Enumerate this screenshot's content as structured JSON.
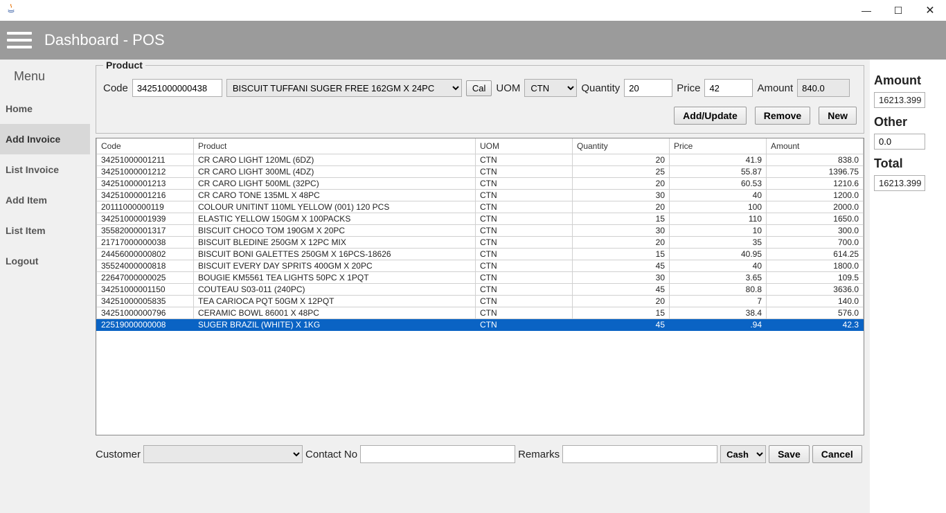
{
  "window": {
    "title": "Dashboard - POS"
  },
  "sidebar": {
    "menu_label": "Menu",
    "items": [
      {
        "label": "Home"
      },
      {
        "label": "Add Invoice"
      },
      {
        "label": "List Invoice"
      },
      {
        "label": "Add Item"
      },
      {
        "label": "List Item"
      },
      {
        "label": "Logout"
      }
    ],
    "active_index": 1
  },
  "product": {
    "legend": "Product",
    "code_label": "Code",
    "code_value": "34251000000438",
    "name_value": "BISCUIT TUFFANI SUGER FREE 162GM X 24PC",
    "cal_label": "Cal",
    "uom_label": "UOM",
    "uom_value": "CTN",
    "qty_label": "Quantity",
    "qty_value": "20",
    "price_label": "Price",
    "price_value": "42",
    "amount_label": "Amount",
    "amount_value": "840.0"
  },
  "buttons": {
    "add_update": "Add/Update",
    "remove": "Remove",
    "new": "New",
    "save": "Save",
    "cancel": "Cancel"
  },
  "table": {
    "headers": [
      "Code",
      "Product",
      "UOM",
      "Quantity",
      "Price",
      "Amount"
    ],
    "rows": [
      {
        "code": "34251000001211",
        "product": "CR CARO LIGHT 120ML (6DZ)",
        "uom": "CTN",
        "qty": "20",
        "price": "41.9",
        "amount": "838.0"
      },
      {
        "code": "34251000001212",
        "product": "CR CARO LIGHT 300ML (4DZ)",
        "uom": "CTN",
        "qty": "25",
        "price": "55.87",
        "amount": "1396.75"
      },
      {
        "code": "34251000001213",
        "product": "CR CARO LIGHT 500ML (32PC)",
        "uom": "CTN",
        "qty": "20",
        "price": "60.53",
        "amount": "1210.6"
      },
      {
        "code": "34251000001216",
        "product": "CR CARO TONE 135ML X 48PC",
        "uom": "CTN",
        "qty": "30",
        "price": "40",
        "amount": "1200.0"
      },
      {
        "code": "20111000000119",
        "product": "COLOUR UNITINT 110ML YELLOW (001) 120 PCS",
        "uom": "CTN",
        "qty": "20",
        "price": "100",
        "amount": "2000.0"
      },
      {
        "code": "34251000001939",
        "product": "ELASTIC YELLOW 150GM X 100PACKS",
        "uom": "CTN",
        "qty": "15",
        "price": "110",
        "amount": "1650.0"
      },
      {
        "code": "35582000001317",
        "product": "BISCUIT  CHOCO TOM 190GM X 20PC",
        "uom": "CTN",
        "qty": "30",
        "price": "10",
        "amount": "300.0"
      },
      {
        "code": "21717000000038",
        "product": "BISCUIT BLEDINE 250GM X 12PC MIX",
        "uom": "CTN",
        "qty": "20",
        "price": "35",
        "amount": "700.0"
      },
      {
        "code": "24456000000802",
        "product": "BISCUIT BONI GALETTES 250GM X 16PCS-18626",
        "uom": "CTN",
        "qty": "15",
        "price": "40.95",
        "amount": "614.25"
      },
      {
        "code": "35524000000818",
        "product": "BISCUIT EVERY DAY SPRITS 400GM X 20PC",
        "uom": "CTN",
        "qty": "45",
        "price": "40",
        "amount": "1800.0"
      },
      {
        "code": "22647000000025",
        "product": "BOUGIE KM5561 TEA LIGHTS 50PC X 1PQT",
        "uom": "CTN",
        "qty": "30",
        "price": "3.65",
        "amount": "109.5"
      },
      {
        "code": "34251000001150",
        "product": "COUTEAU S03-011 (240PC)",
        "uom": "CTN",
        "qty": "45",
        "price": "80.8",
        "amount": "3636.0"
      },
      {
        "code": "34251000005835",
        "product": "TEA CARIOCA PQT 50GM X 12PQT",
        "uom": "CTN",
        "qty": "20",
        "price": "7",
        "amount": "140.0"
      },
      {
        "code": "34251000000796",
        "product": "CERAMIC BOWL 86001 X 48PC",
        "uom": "CTN",
        "qty": "15",
        "price": "38.4",
        "amount": "576.0"
      },
      {
        "code": "22519000000008",
        "product": "SUGER BRAZIL (WHITE) X 1KG",
        "uom": "CTN",
        "qty": "45",
        "price": ".94",
        "amount": "42.3",
        "selected": true
      }
    ]
  },
  "bottom": {
    "customer_label": "Customer",
    "customer_value": "",
    "contact_label": "Contact No",
    "contact_value": "",
    "remarks_label": "Remarks",
    "remarks_value": "",
    "payment_value": "Cash"
  },
  "summary": {
    "amount_label": "Amount",
    "amount_value": "16213.399",
    "other_label": "Other",
    "other_value": "0.0",
    "total_label": "Total",
    "total_value": "16213.399"
  }
}
